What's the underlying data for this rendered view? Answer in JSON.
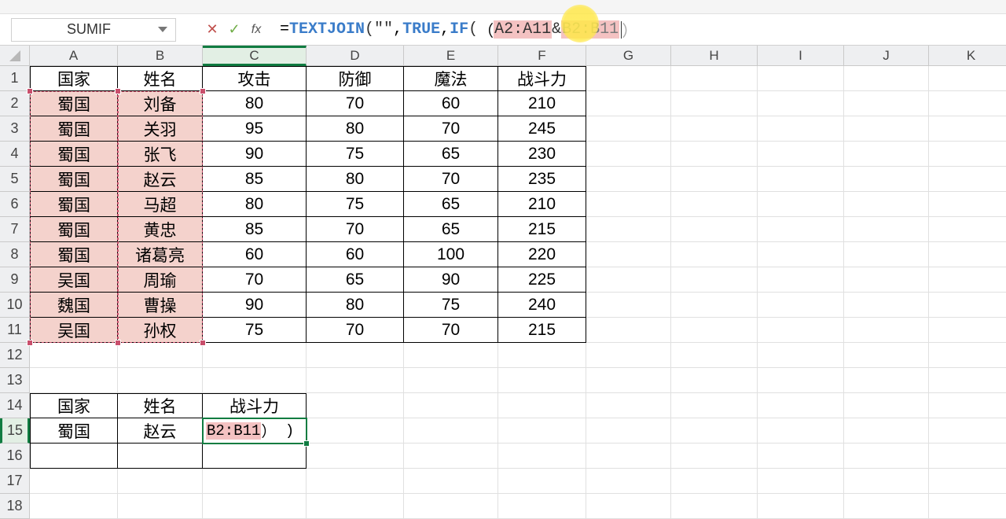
{
  "nameBox": "SUMIF",
  "formula": {
    "prefix": "=",
    "fn1": "TEXTJOIN",
    "open1": "(",
    "str": "\"\"",
    "comma1": ",",
    "arg_true": "TRUE",
    "comma2": ",",
    "fn2": "IF",
    "open2": "(",
    "open3": "（",
    "range1": "A2:A11",
    "amp": "&",
    "range2": "B2:B11",
    "close3": "）"
  },
  "activeCellFormula": {
    "range": "B2:B11",
    "close": "）",
    "tail": ")"
  },
  "columns": [
    "A",
    "B",
    "C",
    "D",
    "E",
    "F",
    "G",
    "H",
    "I",
    "J",
    "K"
  ],
  "rows": [
    "1",
    "2",
    "3",
    "4",
    "5",
    "6",
    "7",
    "8",
    "9",
    "10",
    "11",
    "12",
    "13",
    "14",
    "15",
    "16",
    "17",
    "18"
  ],
  "headers": {
    "A": "国家",
    "B": "姓名",
    "C": "攻击",
    "D": "防御",
    "E": "魔法",
    "F": "战斗力"
  },
  "data": [
    {
      "A": "蜀国",
      "B": "刘备",
      "C": "80",
      "D": "70",
      "E": "60",
      "F": "210"
    },
    {
      "A": "蜀国",
      "B": "关羽",
      "C": "95",
      "D": "80",
      "E": "70",
      "F": "245"
    },
    {
      "A": "蜀国",
      "B": "张飞",
      "C": "90",
      "D": "75",
      "E": "65",
      "F": "230"
    },
    {
      "A": "蜀国",
      "B": "赵云",
      "C": "85",
      "D": "80",
      "E": "70",
      "F": "235"
    },
    {
      "A": "蜀国",
      "B": "马超",
      "C": "80",
      "D": "75",
      "E": "65",
      "F": "210"
    },
    {
      "A": "蜀国",
      "B": "黄忠",
      "C": "85",
      "D": "70",
      "E": "65",
      "F": "215"
    },
    {
      "A": "蜀国",
      "B": "诸葛亮",
      "C": "60",
      "D": "60",
      "E": "100",
      "F": "220"
    },
    {
      "A": "吴国",
      "B": "周瑜",
      "C": "70",
      "D": "65",
      "E": "90",
      "F": "225"
    },
    {
      "A": "魏国",
      "B": "曹操",
      "C": "90",
      "D": "80",
      "E": "75",
      "F": "240"
    },
    {
      "A": "吴国",
      "B": "孙权",
      "C": "75",
      "D": "70",
      "E": "70",
      "F": "215"
    }
  ],
  "lookup": {
    "headers": {
      "A": "国家",
      "B": "姓名",
      "C": "战斗力"
    },
    "row": {
      "A": "蜀国",
      "B": "赵云"
    }
  },
  "colors": {
    "accent": "#107c41",
    "rangeHighlight": "#f4d2cc",
    "marker": "#ffe84a"
  }
}
